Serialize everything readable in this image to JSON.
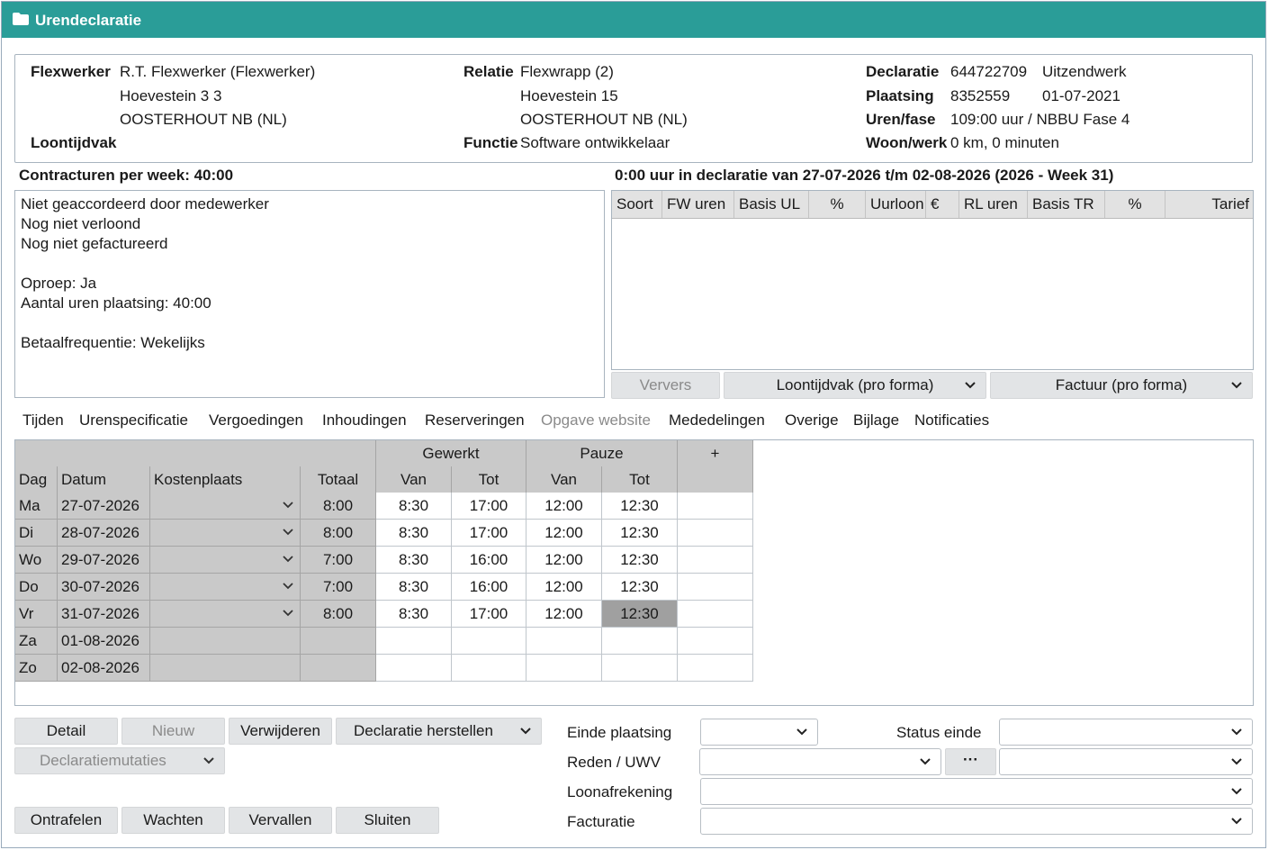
{
  "window": {
    "title": "Urendeclaratie"
  },
  "info": {
    "flexwerker_label": "Flexwerker",
    "flexwerker_name": "R.T. Flexwerker (Flexwerker)",
    "flexwerker_address1": "Hoevestein 3 3",
    "flexwerker_address2": "OOSTERHOUT NB (NL)",
    "loontijdvak_label": "Loontijdvak",
    "relatie_label": "Relatie",
    "relatie_name": "Flexwrapp (2)",
    "relatie_address1": "Hoevestein 15",
    "relatie_address2": "OOSTERHOUT NB (NL)",
    "functie_label": "Functie",
    "functie_value": "Software ontwikkelaar",
    "declaratie_label": "Declaratie",
    "declaratie_nr": "644722709",
    "declaratie_type": "Uitzendwerk",
    "plaatsing_label": "Plaatsing",
    "plaatsing_nr": "8352559",
    "plaatsing_date": "01-07-2021",
    "urenfase_label": "Uren/fase",
    "urenfase_value": "109:00 uur / NBBU Fase 4",
    "woonwerk_label": "Woon/werk",
    "woonwerk_value": "0 km, 0 minuten"
  },
  "contract_heading": "Contracturen per week: 40:00",
  "declaration_heading": "0:00 uur in declaratie van 27-07-2026 t/m 02-08-2026 (2026 - Week 31)",
  "status_lines": [
    "Niet geaccordeerd door medewerker",
    "Nog niet verloond",
    "Nog niet gefactureerd",
    "",
    "Oproep: Ja",
    "Aantal uren plaatsing: 40:00",
    "",
    "Betaalfrequentie: Wekelijks"
  ],
  "decl_columns": [
    "Soort",
    "FW uren",
    "Basis UL",
    "%",
    "Uurloon",
    "€",
    "RL uren",
    "Basis TR",
    "%",
    "Tarief"
  ],
  "buttons": {
    "ververs": "Ververs",
    "loontijdvak": "Loontijdvak (pro forma)",
    "factuur": "Factuur (pro forma)",
    "detail": "Detail",
    "nieuw": "Nieuw",
    "verwijderen": "Verwijderen",
    "declaratie_herstellen": "Declaratie herstellen",
    "declaratiemutaties": "Declaratiemutaties",
    "ontrafelen": "Ontrafelen",
    "wachten": "Wachten",
    "vervallen": "Vervallen",
    "sluiten": "Sluiten",
    "ellipsis": "···"
  },
  "tabs": [
    {
      "label": "Tijden",
      "enabled": true
    },
    {
      "label": "Urenspecificatie",
      "enabled": true
    },
    {
      "label": "Vergoedingen",
      "enabled": true
    },
    {
      "label": "Inhoudingen",
      "enabled": true
    },
    {
      "label": "Reserveringen",
      "enabled": true
    },
    {
      "label": "Opgave website",
      "enabled": false
    },
    {
      "label": "Mededelingen",
      "enabled": true
    },
    {
      "label": "Overige",
      "enabled": true
    },
    {
      "label": "Bijlage",
      "enabled": true
    },
    {
      "label": "Notificaties",
      "enabled": true
    }
  ],
  "grid": {
    "group_gewerkt": "Gewerkt",
    "group_pauze": "Pauze",
    "add_label": "+",
    "col_dag": "Dag",
    "col_datum": "Datum",
    "col_kostenplaats": "Kostenplaats",
    "col_totaal": "Totaal",
    "col_van": "Van",
    "col_tot": "Tot",
    "rows": [
      {
        "dag": "Ma",
        "datum": "27-07-2026",
        "totaal": "8:00",
        "gv": "8:30",
        "gt": "17:00",
        "pv": "12:00",
        "pt": "12:30"
      },
      {
        "dag": "Di",
        "datum": "28-07-2026",
        "totaal": "8:00",
        "gv": "8:30",
        "gt": "17:00",
        "pv": "12:00",
        "pt": "12:30"
      },
      {
        "dag": "Wo",
        "datum": "29-07-2026",
        "totaal": "7:00",
        "gv": "8:30",
        "gt": "16:00",
        "pv": "12:00",
        "pt": "12:30"
      },
      {
        "dag": "Do",
        "datum": "30-07-2026",
        "totaal": "7:00",
        "gv": "8:30",
        "gt": "16:00",
        "pv": "12:00",
        "pt": "12:30"
      },
      {
        "dag": "Vr",
        "datum": "31-07-2026",
        "totaal": "8:00",
        "gv": "8:30",
        "gt": "17:00",
        "pv": "12:00",
        "pt": "12:30"
      },
      {
        "dag": "Za",
        "datum": "01-08-2026",
        "totaal": "",
        "gv": "",
        "gt": "",
        "pv": "",
        "pt": ""
      },
      {
        "dag": "Zo",
        "datum": "02-08-2026",
        "totaal": "",
        "gv": "",
        "gt": "",
        "pv": "",
        "pt": ""
      }
    ]
  },
  "form": {
    "einde_plaatsing": "Einde plaatsing",
    "status_einde": "Status einde",
    "reden_uwv": "Reden / UWV",
    "loonafrekening": "Loonafrekening",
    "facturatie": "Facturatie"
  },
  "icons": {
    "folder": "folder-icon",
    "dropdown": "chevron-down-icon"
  },
  "colors": {
    "titlebar": "#2a9d98",
    "grid_gray": "#c9c9c9",
    "selected_cell": "#a0a0a0"
  }
}
